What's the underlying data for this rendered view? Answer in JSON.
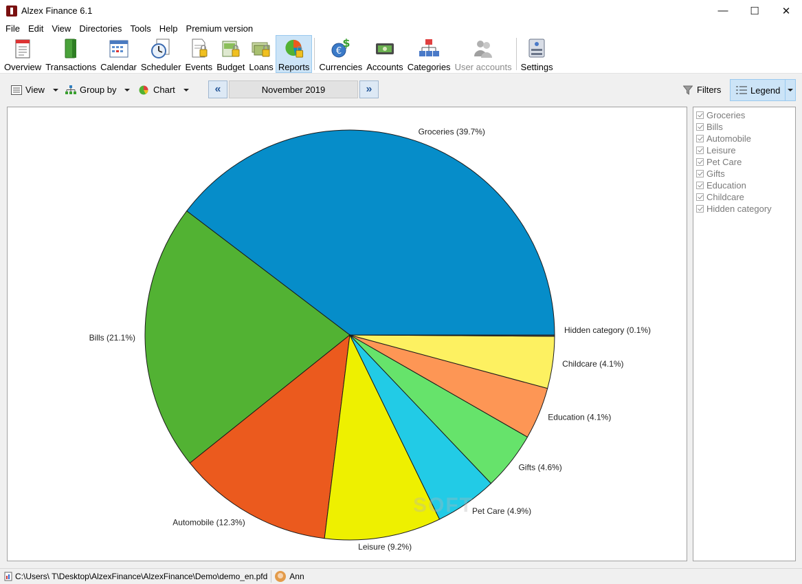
{
  "window": {
    "title": "Alzex Finance 6.1",
    "minimize": "—",
    "maximize": "☐",
    "close": "✕"
  },
  "menu": [
    "File",
    "Edit",
    "View",
    "Directories",
    "Tools",
    "Help",
    "Premium version"
  ],
  "toolbar": {
    "overview": "Overview",
    "transactions": "Transactions",
    "calendar": "Calendar",
    "scheduler": "Scheduler",
    "events": "Events",
    "budget": "Budget",
    "loans": "Loans",
    "reports": "Reports",
    "currencies": "Currencies",
    "accounts": "Accounts",
    "categories": "Categories",
    "user_accounts": "User accounts",
    "settings": "Settings"
  },
  "subbar": {
    "view": "View",
    "group_by": "Group by",
    "chart": "Chart",
    "prev": "«",
    "next": "»",
    "period": "November 2019",
    "filters": "Filters",
    "legend": "Legend"
  },
  "chart_data": {
    "type": "pie",
    "categories": [
      "Groceries",
      "Bills",
      "Automobile",
      "Leisure",
      "Pet Care",
      "Gifts",
      "Education",
      "Childcare",
      "Hidden category"
    ],
    "values": [
      39.7,
      21.1,
      12.3,
      9.2,
      4.9,
      4.6,
      4.1,
      4.1,
      0.1
    ],
    "labels": [
      "Groceries (39.7%)",
      "Bills (21.1%)",
      "Automobile (12.3%)",
      "Leisure (9.2%)",
      "Pet Care (4.9%)",
      "Gifts (4.6%)",
      "Education (4.1%)",
      "Childcare (4.1%)",
      "Hidden category (0.1%)"
    ],
    "colors": [
      "#068dc9",
      "#52b233",
      "#eb5a1e",
      "#eef000",
      "#22cbe6",
      "#66e36b",
      "#fd9655",
      "#fdf161",
      "#4f4f4f"
    ],
    "start": "3 o'clock",
    "direction": "counter-clockwise"
  },
  "legend_panel": [
    "Groceries",
    "Bills",
    "Automobile",
    "Leisure",
    "Pet Care",
    "Gifts",
    "Education",
    "Childcare",
    "Hidden category"
  ],
  "watermark": "SOFT",
  "status": {
    "path": "C:\\Users\\ T\\Desktop\\AlzexFinance\\AlzexFinance\\Demo\\demo_en.pfd",
    "user": "Ann"
  }
}
